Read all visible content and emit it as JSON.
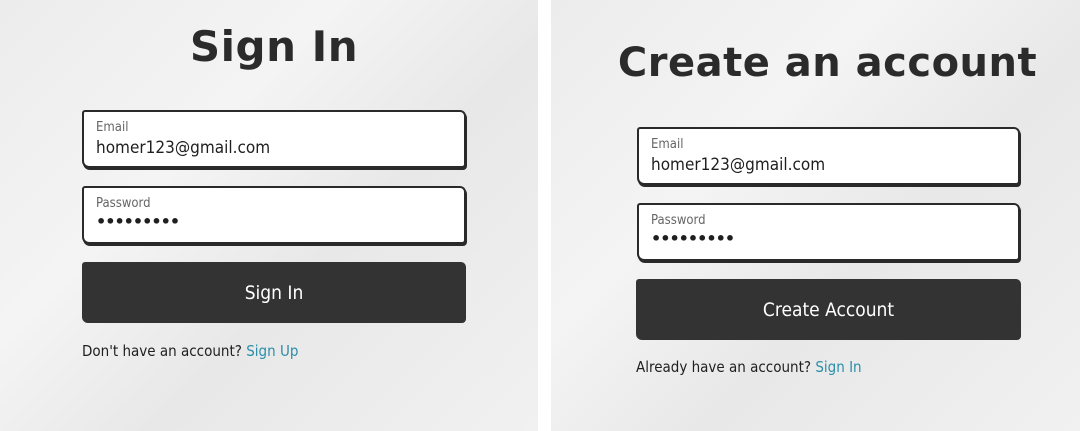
{
  "sign_in": {
    "title": "Sign In",
    "email": {
      "label": "Email",
      "value": "homer123@gmail.com"
    },
    "password": {
      "label": "Password",
      "value": "•••••••••"
    },
    "submit_label": "Sign In",
    "switch_prompt": "Don't have an account?",
    "switch_link": "Sign Up"
  },
  "create_account": {
    "title": "Create an account",
    "email": {
      "label": "Email",
      "value": "homer123@gmail.com"
    },
    "password": {
      "label": "Password",
      "value": "•••••••••"
    },
    "submit_label": "Create Account",
    "switch_prompt": "Already have an account?",
    "switch_link": "Sign In"
  },
  "colors": {
    "button_bg": "#333333",
    "link": "#2b8ea8",
    "text": "#2b2b2b"
  }
}
